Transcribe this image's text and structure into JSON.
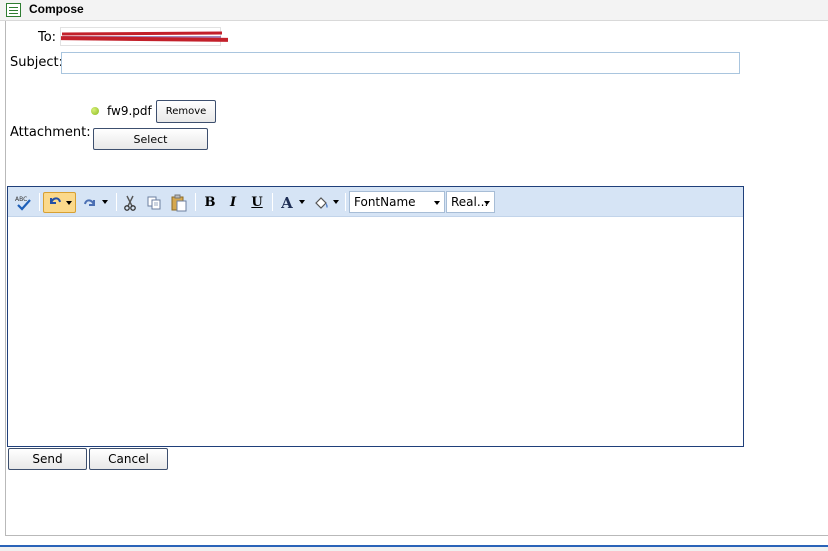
{
  "window": {
    "title": "Compose"
  },
  "form": {
    "to_label": "To:",
    "subject_label": "Subject:",
    "subject_value": "",
    "attachment_label": "Attachment:",
    "attachment_file": "fw9.pdf",
    "remove_label": "Remove",
    "select_label": "Select"
  },
  "editor": {
    "font_name": "FontName",
    "font_size": "Real...",
    "icons": [
      "spellcheck-icon",
      "undo-icon",
      "redo-icon",
      "cut-icon",
      "copy-icon",
      "paste-icon",
      "bold-icon",
      "italic-icon",
      "underline-icon",
      "font-color-icon",
      "highlight-color-icon"
    ]
  },
  "actions": {
    "send_label": "Send",
    "cancel_label": "Cancel"
  },
  "colors": {
    "redaction": "#c3202a",
    "editor_border": "#1f3f7a",
    "toolbar_bg": "#d6e4f5",
    "attachment_dot": "#8aba1f"
  }
}
